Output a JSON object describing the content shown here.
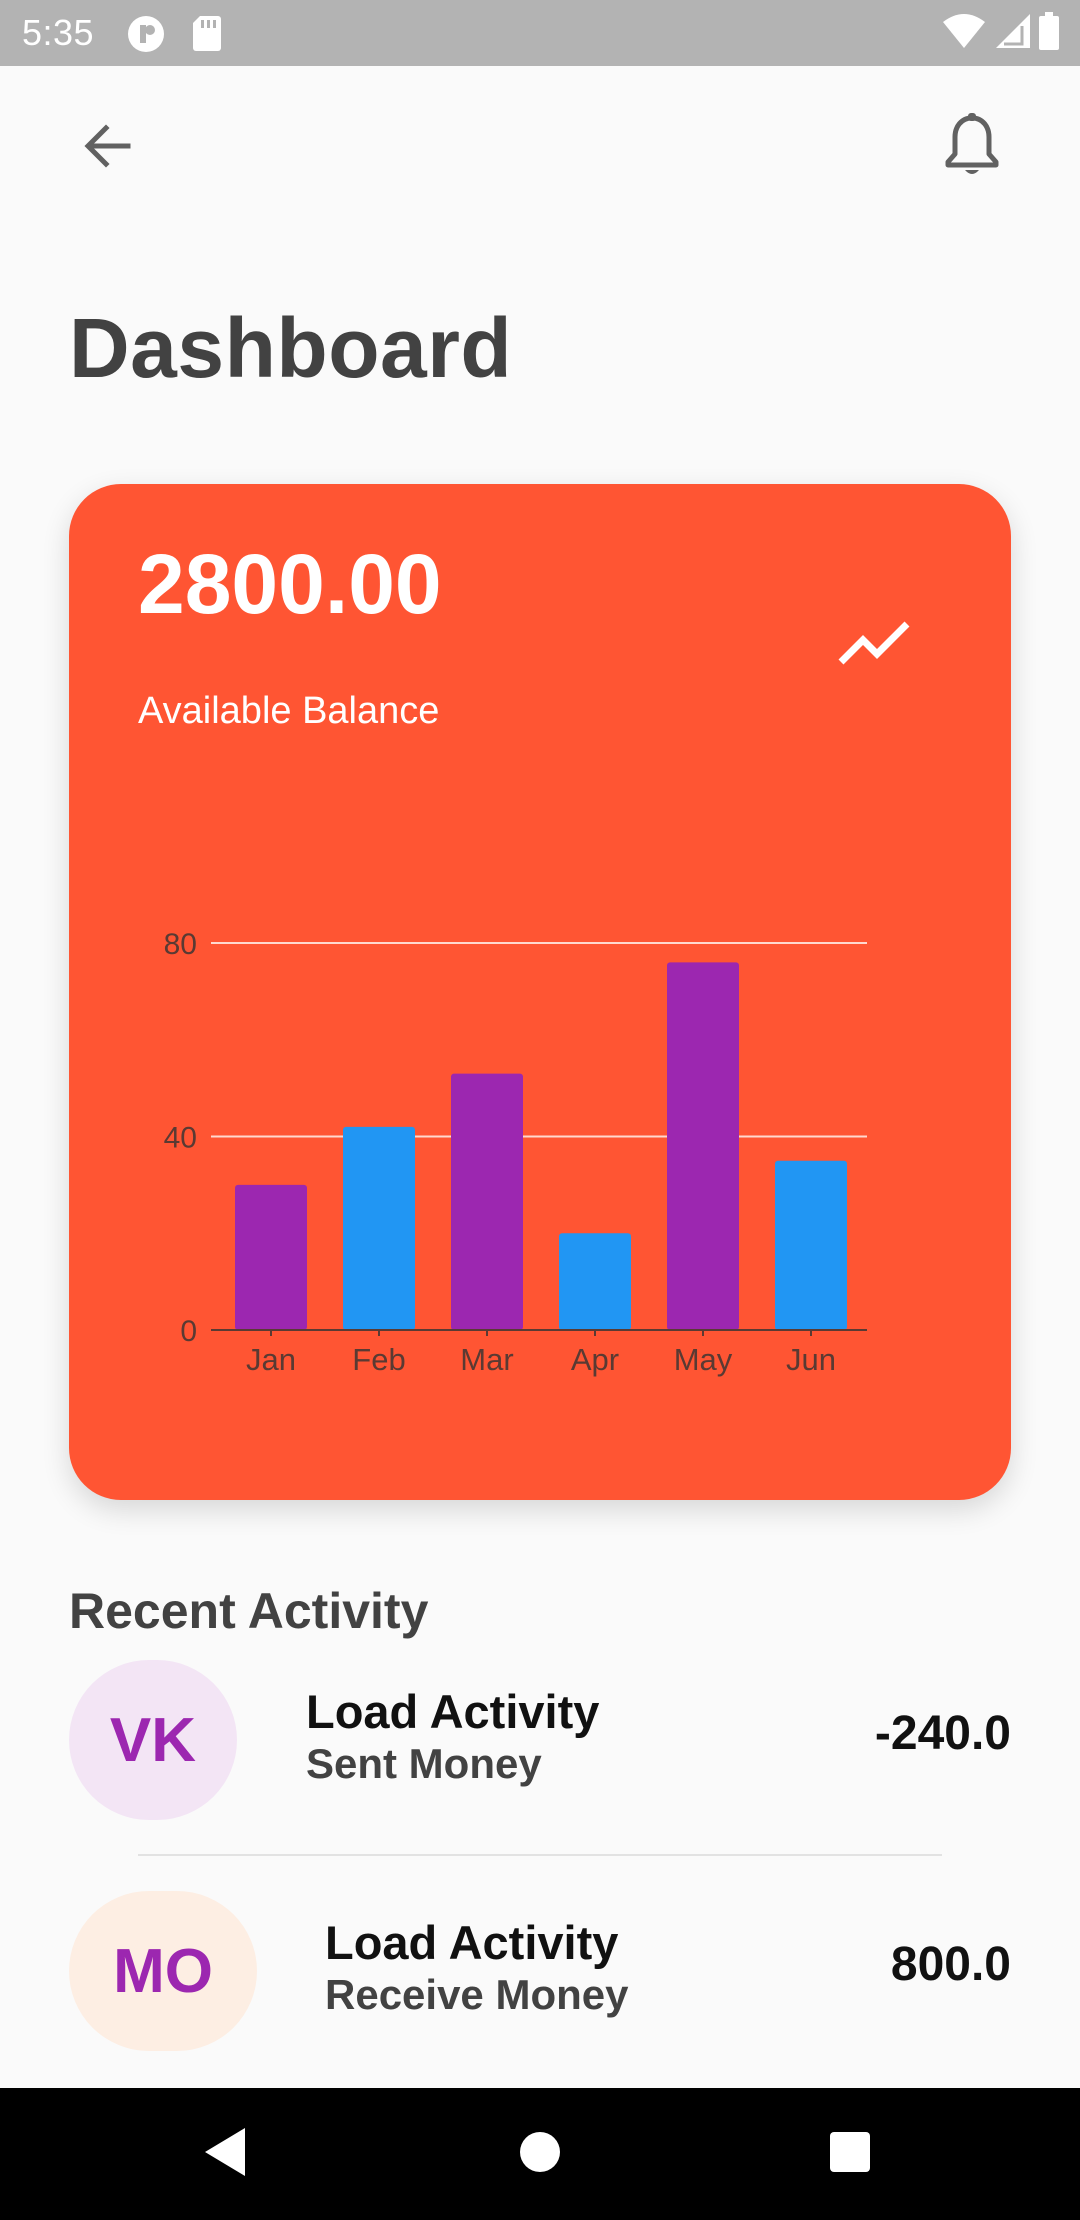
{
  "status_bar": {
    "time": "5:35",
    "icons": [
      "app-notification-icon",
      "sd-card-icon",
      "wifi-icon",
      "cell-signal-icon",
      "battery-icon"
    ]
  },
  "app_bar": {
    "back_icon": "arrow-back-icon",
    "notification_icon": "bell-icon"
  },
  "page": {
    "title": "Dashboard"
  },
  "balance_card": {
    "amount": "2800.00",
    "label": "Available Balance",
    "trend_icon": "trending-up-icon",
    "background": "#ff5533"
  },
  "chart_data": {
    "type": "bar",
    "categories": [
      "Jan",
      "Feb",
      "Mar",
      "Apr",
      "May",
      "Jun"
    ],
    "values": [
      30,
      42,
      53,
      20,
      76,
      35
    ],
    "bar_colors": [
      "#9c27b0",
      "#2196f3",
      "#9c27b0",
      "#2196f3",
      "#9c27b0",
      "#2196f3"
    ],
    "yticks": [
      0,
      40,
      80
    ],
    "ylim": [
      0,
      80
    ],
    "grid": true,
    "title": "",
    "xlabel": "",
    "ylabel": ""
  },
  "recent_activity": {
    "title": "Recent Activity",
    "items": [
      {
        "initials": "VK",
        "title": "Load Activity",
        "subtitle": "Sent Money",
        "amount": "-240.0",
        "avatar_bg": "#f3e5f5",
        "avatar_fg": "#9c27b0"
      },
      {
        "initials": "MO",
        "title": "Load Activity",
        "subtitle": "Receive Money",
        "amount": "800.0",
        "avatar_bg": "#fdeee3",
        "avatar_fg": "#9c27b0"
      }
    ]
  },
  "nav_bar": {
    "icons": [
      "nav-back-icon",
      "nav-home-icon",
      "nav-recents-icon"
    ]
  }
}
